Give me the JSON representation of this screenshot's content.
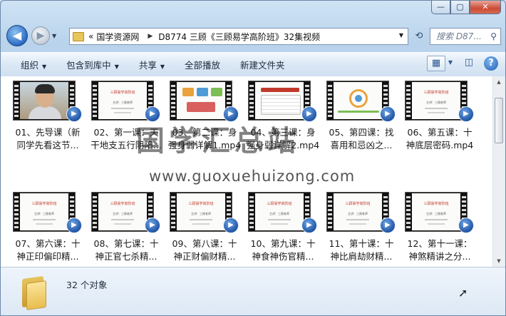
{
  "window": {
    "buttons": {
      "minimize": "—",
      "maximize": "▢",
      "close": "✕"
    }
  },
  "nav": {
    "back_glyph": "◀",
    "forward_glyph": "▶",
    "breadcrumb_prefix": "«",
    "breadcrumb": [
      "国学资源网",
      "D8774 三顾《三顾易学高阶班》32集视频"
    ],
    "search_placeholder": "搜索 D87...",
    "refresh_glyph": "⟲"
  },
  "toolbar": {
    "items": [
      "组织",
      "包含到库中",
      "共享",
      "全部播放",
      "新建文件夹"
    ],
    "dropdown_flags": [
      true,
      true,
      true,
      false,
      false
    ]
  },
  "files": [
    {
      "label": "01、先导课（新\n同学先看这节...",
      "thumb": "person"
    },
    {
      "label": "02、第一课：天\n干地支五行阴阳...",
      "thumb": "slide"
    },
    {
      "label": "03、第二课：身\n强身弱详解1.mp4",
      "thumb": "diagram"
    },
    {
      "label": "04、第三课：身\n强身弱详解2.mp4",
      "thumb": "table"
    },
    {
      "label": "05、第四课：找\n喜用和忌凶之...",
      "thumb": "wheel"
    },
    {
      "label": "06、第五课：十\n神底层密码.mp4",
      "thumb": "slide"
    },
    {
      "label": "07、第六课：十\n神正印偏印精...",
      "thumb": "slide"
    },
    {
      "label": "08、第七课：十\n神正官七杀精...",
      "thumb": "slide"
    },
    {
      "label": "09、第八课：十\n神正财偏财精...",
      "thumb": "slide"
    },
    {
      "label": "10、第九课：十\n神食神伤官精...",
      "thumb": "slide"
    },
    {
      "label": "11、第十课：十\n神比肩劫财精...",
      "thumb": "slide"
    },
    {
      "label": "12、第十一课：\n神煞精讲之分...",
      "thumb": "slide"
    }
  ],
  "slide_text": {
    "title": "三顾易学高阶班",
    "subtitle": "主讲：三顾老师"
  },
  "watermark": {
    "cn": "国学汇总站",
    "url": "www.guoxuehuizong.com"
  },
  "status": {
    "count": "32 个对象"
  },
  "colors": {
    "accent": "#1f5fb5",
    "folder": "#e8bd4d",
    "slide_title": "#c0392b"
  }
}
